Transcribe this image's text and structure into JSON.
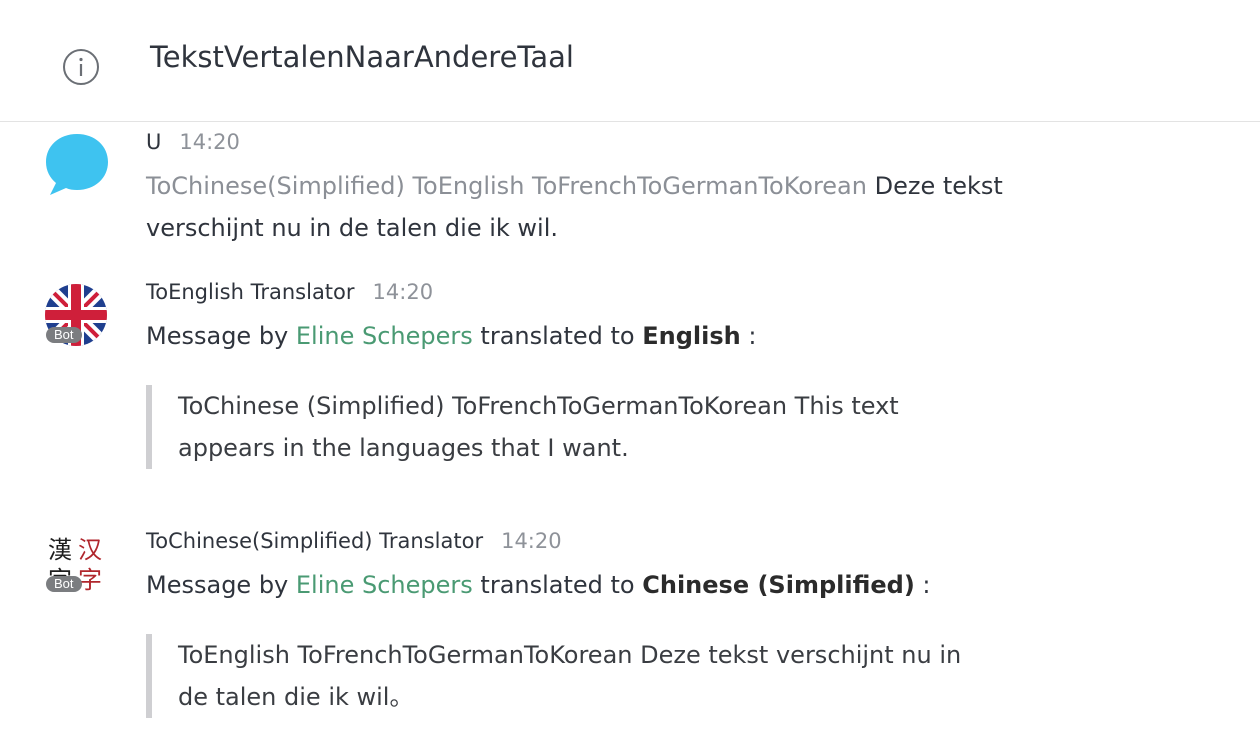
{
  "header": {
    "icon": "info-icon",
    "title": "TekstVertalenNaarAndereTaal"
  },
  "messages": [
    {
      "avatar_icon": "chat-bubble-icon",
      "sender": "U",
      "time": "14:20",
      "commands": "ToChinese(Simplified) ToEnglish ToFrenchToGermanToKorean",
      "text_rest": " Deze tekst",
      "text_line2": "verschijnt nu in de talen die ik wil."
    },
    {
      "avatar_icon": "uk-flag-icon",
      "badge": "Bot",
      "sender": "ToEnglish Translator",
      "time": "14:20",
      "prefix": "Message by ",
      "author": "Eline Schepers",
      "middle": " translated to ",
      "language": "English",
      "suffix": " :",
      "quote_line1": "ToChinese (Simplified) ToFrenchToGermanToKorean This text",
      "quote_line2": "appears in the languages that I want."
    },
    {
      "avatar_icon": "hanzi-icon",
      "avatar_glyphs": [
        "漢",
        "汉",
        "字",
        "字"
      ],
      "badge": "Bot",
      "sender": "ToChinese(Simplified) Translator",
      "time": "14:20",
      "prefix": "Message by ",
      "author": "Eline Schepers",
      "middle": " translated to ",
      "language": "Chinese (Simplified)",
      "suffix": " :",
      "quote_line1": "ToEnglish ToFrenchToGermanToKorean Deze tekst verschijnt nu in",
      "quote_line2": "de talen die ik wil。"
    }
  ],
  "colors": {
    "accent_link": "#4a9a73",
    "bubble_blue": "#3ec3f0",
    "muted_text": "#8b8f96",
    "badge_bg": "#7b7d80"
  }
}
